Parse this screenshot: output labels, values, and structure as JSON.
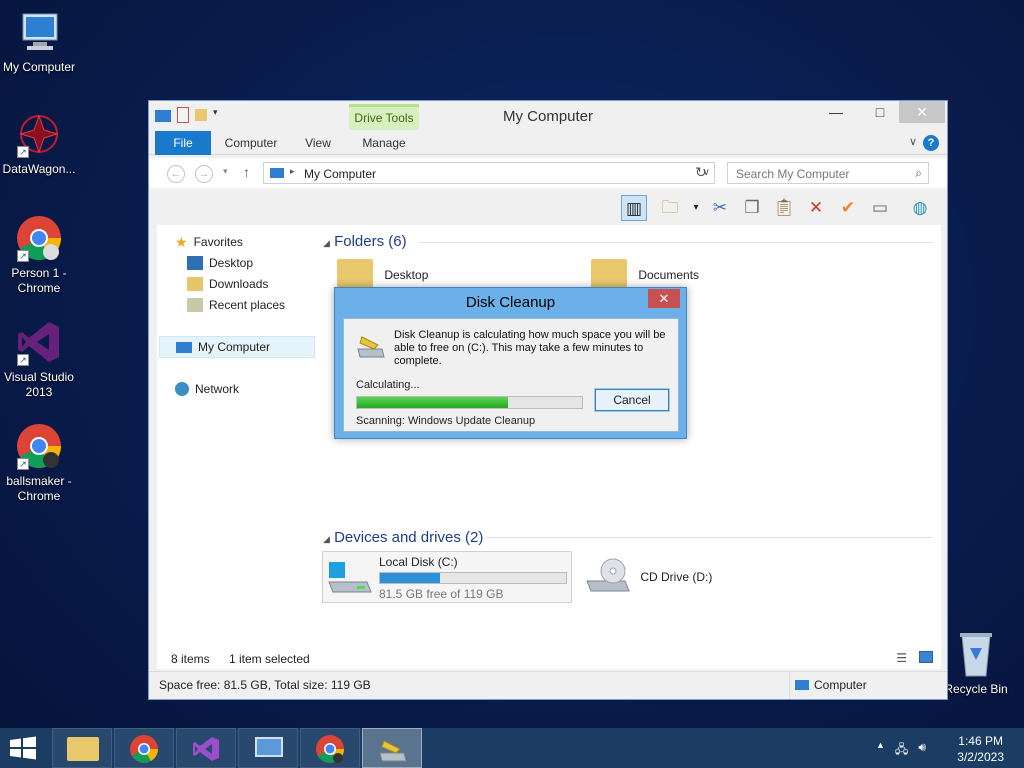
{
  "desktop": {
    "icons": [
      {
        "label": "My Computer",
        "icon": "computer-icon"
      },
      {
        "label": "DataWagon...",
        "icon": "datawagon-icon"
      },
      {
        "label": "Person 1 - Chrome",
        "icon": "chrome-icon"
      },
      {
        "label": "Visual Studio 2013",
        "icon": "visual-studio-icon"
      },
      {
        "label": "ballsmaker - Chrome",
        "icon": "chrome-icon"
      }
    ],
    "recycle_bin": "Recycle Bin"
  },
  "window": {
    "title": "My Computer",
    "contextual_tab": "Drive Tools",
    "tabs": [
      "File",
      "Computer",
      "View",
      "Manage"
    ],
    "address": "My Computer",
    "search_placeholder": "Search My Computer",
    "nav": {
      "favorites": "Favorites",
      "desktop": "Desktop",
      "downloads": "Downloads",
      "recent": "Recent places",
      "my_computer": "My Computer",
      "network": "Network"
    },
    "folders_header": "Folders (6)",
    "folders": [
      "Desktop",
      "Documents"
    ],
    "drives_header": "Devices and drives (2)",
    "drive_c": {
      "name": "Local Disk (C:)",
      "free_text": "81.5 GB free of 119 GB",
      "used_fraction": 0.32
    },
    "drive_d": {
      "name": "CD Drive (D:)"
    },
    "status": {
      "items": "8 items",
      "selected": "1 item selected"
    },
    "details": {
      "space": "Space free: 81.5 GB, Total size: 119 GB",
      "location": "Computer"
    }
  },
  "dialog": {
    "title": "Disk Cleanup",
    "message": "Disk Cleanup is calculating how much space you will be able to free on  (C:). This may take a few minutes to complete.",
    "calculating": "Calculating...",
    "progress_fraction": 0.67,
    "scanning": "Scanning:  Windows Update Cleanup",
    "cancel": "Cancel"
  },
  "taskbar": {
    "time": "1:46 PM",
    "date": "3/2/2023"
  },
  "colors": {
    "accent": "#1979ca",
    "progress": "#21a91c",
    "taskbar": "#1b3d64"
  }
}
